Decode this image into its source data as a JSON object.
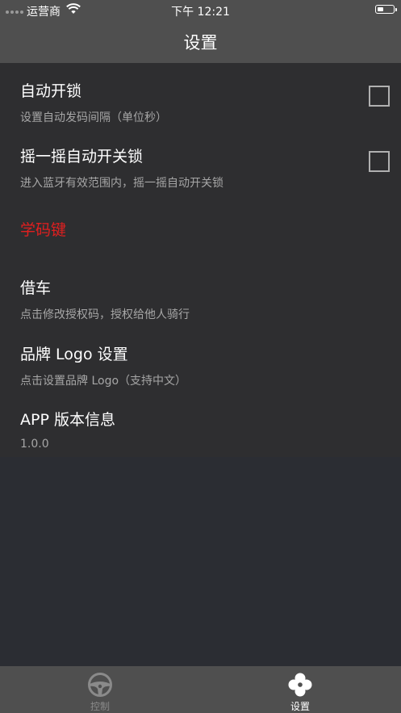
{
  "status_bar": {
    "carrier": "运营商",
    "time": "下午 12:21"
  },
  "header": {
    "title": "设置"
  },
  "settings": {
    "auto_unlock": {
      "title": "自动开锁",
      "subtitle": "设置自动发码间隔（单位秒）"
    },
    "shake_unlock": {
      "title": "摇一摇自动开关锁",
      "subtitle": "进入蓝牙有效范围内，摇一摇自动开关锁"
    },
    "learn_key": {
      "title": "学码键"
    },
    "lend_car": {
      "title": "借车",
      "subtitle": "点击修改授权码，授权给他人骑行"
    },
    "brand_logo": {
      "title": "品牌 Logo 设置",
      "subtitle": "点击设置品牌 Logo（支持中文）"
    },
    "app_version": {
      "title": "APP 版本信息",
      "subtitle": "1.0.0"
    }
  },
  "tabbar": {
    "tabs": [
      {
        "label": "控制",
        "icon": "steering-wheel-icon",
        "active": false
      },
      {
        "label": "设置",
        "icon": "settings-clover-icon",
        "active": true
      }
    ]
  },
  "colors": {
    "header_bg": "#4f4f4f",
    "content_bg": "#2e2e30",
    "page_bg": "#2b2d33",
    "accent_red": "#e21f1f",
    "inactive_tab": "#8a8a8a"
  }
}
